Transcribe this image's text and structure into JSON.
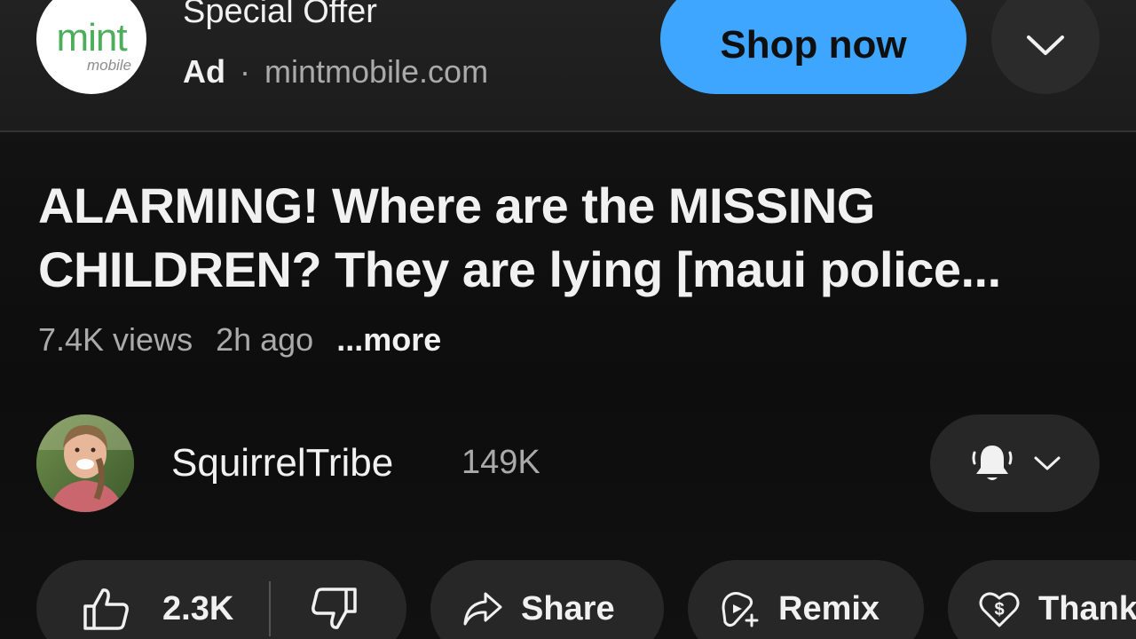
{
  "ad": {
    "logo_text": "mint",
    "logo_subtext": "mobile",
    "title": "Special Offer",
    "label": "Ad",
    "separator": "·",
    "domain": "mintmobile.com",
    "cta_label": "Shop now",
    "cta_color": "#3ea6ff",
    "more_icon": "chevron-down-icon"
  },
  "video": {
    "title_line1": "ALARMING! Where are the MISSING",
    "title_line2": "CHILDREN? They are lying [maui police...",
    "views": "7.4K views",
    "age": "2h ago",
    "more_label": "...more"
  },
  "channel": {
    "name": "SquirrelTribe",
    "subscribers": "149K",
    "notification_icon": "bell-icon",
    "menu_icon": "chevron-down-icon"
  },
  "actions": {
    "like_count": "2.3K",
    "like_icon": "thumbs-up-icon",
    "dislike_icon": "thumbs-down-icon",
    "share_label": "Share",
    "share_icon": "share-arrow-icon",
    "remix_label": "Remix",
    "remix_icon": "remix-icon",
    "thanks_label": "Thank",
    "thanks_icon": "heart-dollar-icon"
  }
}
